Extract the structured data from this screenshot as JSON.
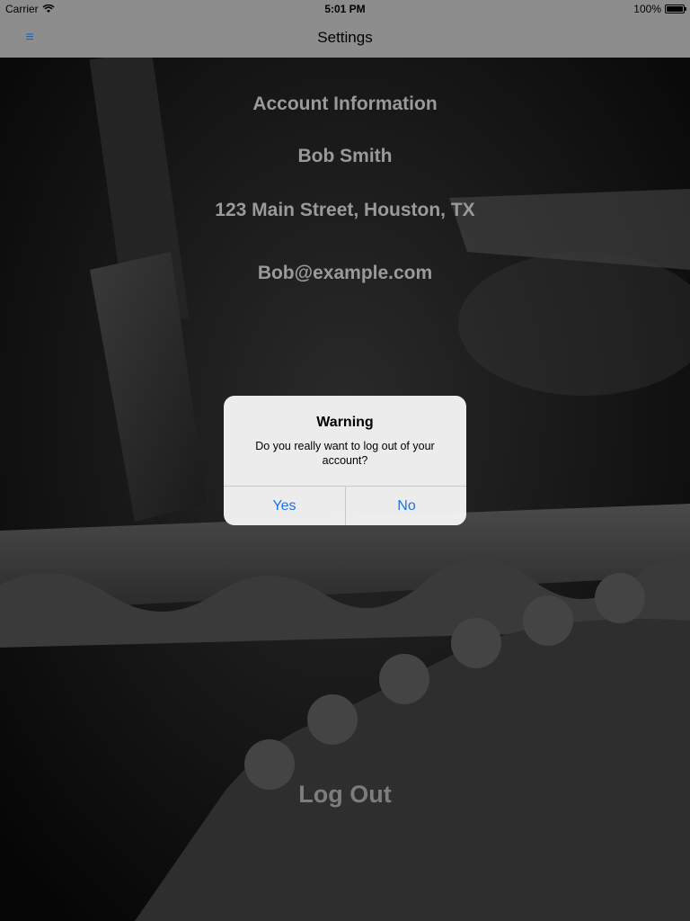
{
  "status_bar": {
    "carrier": "Carrier",
    "time": "5:01 PM",
    "battery": "100%",
    "icons": [
      "wifi-icon",
      "battery-icon"
    ]
  },
  "nav_bar": {
    "title": "Settings",
    "menu_icon": "menu-icon"
  },
  "account": {
    "heading": "Account Information",
    "name": "Bob Smith",
    "address": "123 Main Street, Houston, TX",
    "email": "Bob@example.com"
  },
  "logout_label": "Log Out",
  "alert": {
    "title": "Warning",
    "message": "Do you really want to log out of your account?",
    "yes_label": "Yes",
    "no_label": "No"
  },
  "colors": {
    "bar_bg": "#8d8d8d",
    "accent": "#1a73e8",
    "text_gray": "#9a9a9a"
  }
}
